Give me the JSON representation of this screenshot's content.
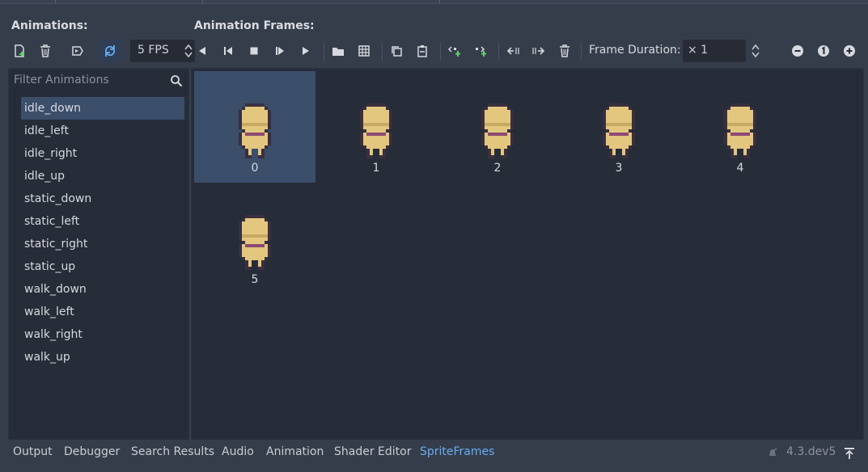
{
  "animations_panel": {
    "title": "Animations:",
    "fps_value": "5 FPS",
    "filter_placeholder": "Filter Animations",
    "items": [
      {
        "label": "idle_down",
        "selected": true
      },
      {
        "label": "idle_left"
      },
      {
        "label": "idle_right"
      },
      {
        "label": "idle_up"
      },
      {
        "label": "static_down"
      },
      {
        "label": "static_left"
      },
      {
        "label": "static_right"
      },
      {
        "label": "static_up"
      },
      {
        "label": "walk_down"
      },
      {
        "label": "walk_left"
      },
      {
        "label": "walk_right"
      },
      {
        "label": "walk_up"
      }
    ]
  },
  "frames_panel": {
    "title": "Animation Frames:",
    "frame_duration_label": "Frame Duration:",
    "frame_duration_value": "× 1",
    "frames": [
      {
        "label": "0",
        "selected": true
      },
      {
        "label": "1"
      },
      {
        "label": "2"
      },
      {
        "label": "3"
      },
      {
        "label": "4"
      },
      {
        "label": "5"
      }
    ]
  },
  "bottom_bar": {
    "tabs": [
      "Output",
      "Debugger",
      "Search Results",
      "Audio",
      "Animation",
      "Shader Editor",
      "SpriteFrames"
    ],
    "active_tab": "SpriteFrames",
    "version": "4.3.dev5"
  },
  "colors": {
    "selection": "#3b4e6a",
    "accent": "#66aef4",
    "add_green": "#5fd068"
  }
}
